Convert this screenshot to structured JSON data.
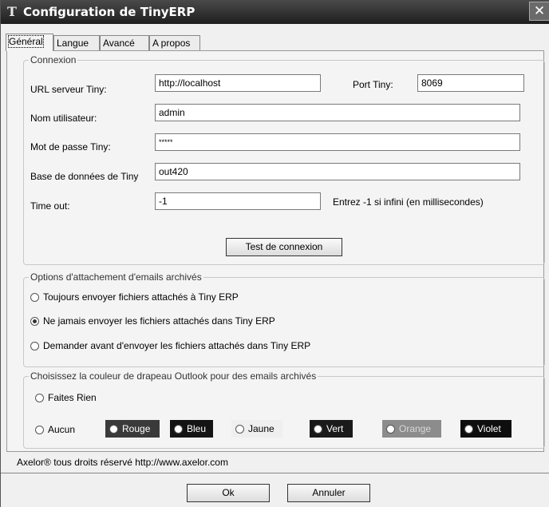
{
  "window": {
    "title": "Configuration de TinyERP",
    "close": "✕"
  },
  "tabs": [
    {
      "label": "Général"
    },
    {
      "label": "Langue"
    },
    {
      "label": "Avancé"
    },
    {
      "label": "A propos"
    }
  ],
  "connexion": {
    "legend": "Connexion",
    "url_label": "URL serveur Tiny:",
    "url_value": "http://localhost",
    "port_label": "Port Tiny:",
    "port_value": "8069",
    "user_label": "Nom utilisateur:",
    "user_value": "admin",
    "password_label": "Mot de passe Tiny:",
    "password_value": "*****",
    "db_label": "Base de données de Tiny",
    "db_value": "out420",
    "timeout_label": "Time out:",
    "timeout_value": "-1",
    "timeout_hint": "Entrez -1 si infini (en millisecondes)",
    "test_button": "Test de connexion"
  },
  "attachments": {
    "legend": "Options d'attachement d'emails archivés",
    "options": [
      {
        "label": "Toujours envoyer fichiers attachés à Tiny ERP",
        "selected": false
      },
      {
        "label": "Ne jamais envoyer les fichiers attachés dans Tiny ERP",
        "selected": true
      },
      {
        "label": "Demander avant d'envoyer les fichiers attachés dans Tiny ERP",
        "selected": false
      }
    ]
  },
  "flags": {
    "legend": "Choisissez la couleur de drapeau Outlook pour des emails archivés",
    "nothing": "Faites Rien",
    "none": "Aucun",
    "colors": [
      {
        "label": "Rouge",
        "bg": "#3a3a3a",
        "fg": "#ffffff"
      },
      {
        "label": "Bleu",
        "bg": "#141414",
        "fg": "#ffffff"
      },
      {
        "label": "Jaune",
        "bg": "#efefef",
        "fg": "#000000"
      },
      {
        "label": "Vert",
        "bg": "#1a1a1a",
        "fg": "#ffffff"
      },
      {
        "label": "Orange",
        "bg": "#8c8c8c",
        "fg": "#d8d8d8"
      },
      {
        "label": "Violet",
        "bg": "#0e0e0e",
        "fg": "#ffffff"
      }
    ]
  },
  "footer": {
    "copyright": "Axelor® tous droits réservé http://www.axelor.com"
  },
  "buttons": {
    "ok": "Ok",
    "cancel": "Annuler"
  }
}
